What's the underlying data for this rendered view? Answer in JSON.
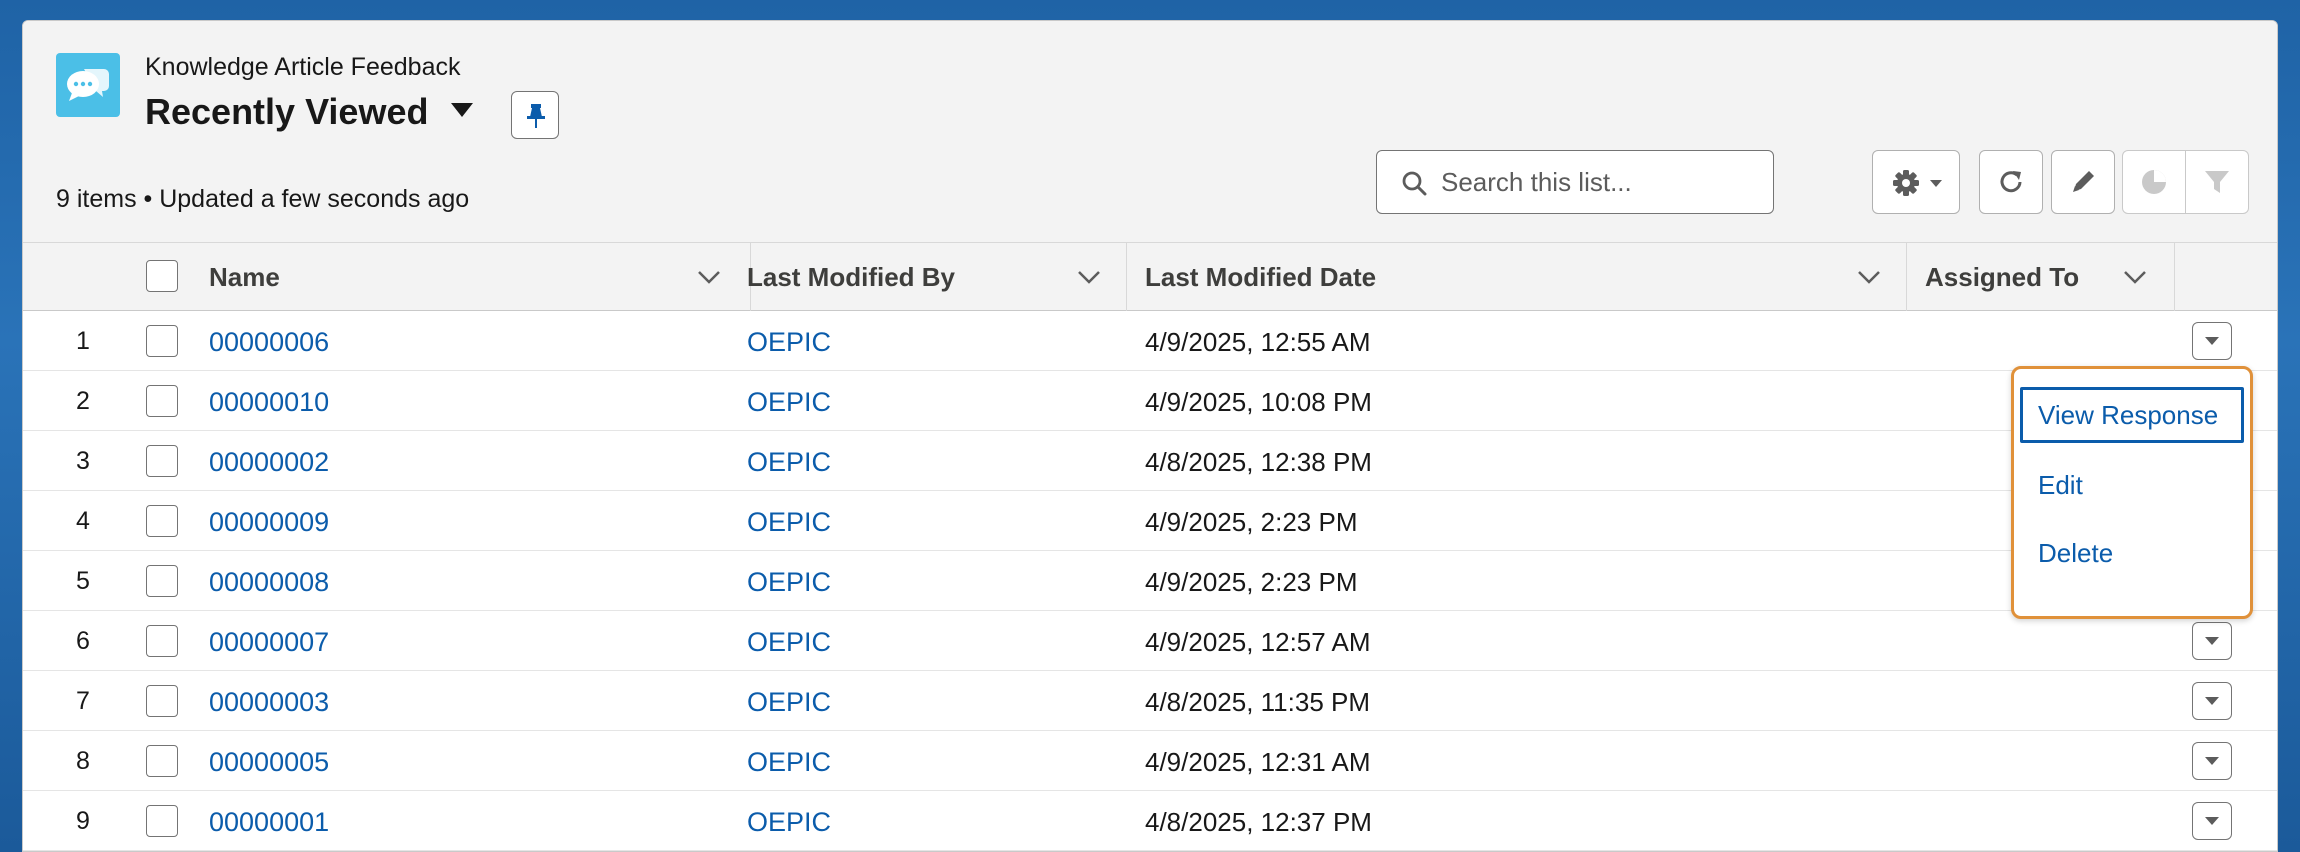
{
  "header": {
    "object_name": "Knowledge Article Feedback",
    "list_title": "Recently Viewed",
    "status": "9 items • Updated a few seconds ago"
  },
  "search": {
    "placeholder": "Search this list...",
    "value": ""
  },
  "toolbar": {
    "icons": [
      "gear-icon",
      "refresh-icon",
      "pencil-icon",
      "chart-icon",
      "filter-icon"
    ]
  },
  "table": {
    "columns": [
      "Name",
      "Last Modified By",
      "Last Modified Date",
      "Assigned To"
    ],
    "rows": [
      {
        "num": "1",
        "name": "00000006",
        "modified_by": "OEPIC",
        "modified_date": "4/9/2025, 12:55 AM"
      },
      {
        "num": "2",
        "name": "00000010",
        "modified_by": "OEPIC",
        "modified_date": "4/9/2025, 10:08 PM"
      },
      {
        "num": "3",
        "name": "00000002",
        "modified_by": "OEPIC",
        "modified_date": "4/8/2025, 12:38 PM"
      },
      {
        "num": "4",
        "name": "00000009",
        "modified_by": "OEPIC",
        "modified_date": "4/9/2025, 2:23 PM"
      },
      {
        "num": "5",
        "name": "00000008",
        "modified_by": "OEPIC",
        "modified_date": "4/9/2025, 2:23 PM"
      },
      {
        "num": "6",
        "name": "00000007",
        "modified_by": "OEPIC",
        "modified_date": "4/9/2025, 12:57 AM"
      },
      {
        "num": "7",
        "name": "00000003",
        "modified_by": "OEPIC",
        "modified_date": "4/8/2025, 11:35 PM"
      },
      {
        "num": "8",
        "name": "00000005",
        "modified_by": "OEPIC",
        "modified_date": "4/9/2025, 12:31 AM"
      },
      {
        "num": "9",
        "name": "00000001",
        "modified_by": "OEPIC",
        "modified_date": "4/8/2025, 12:37 PM"
      }
    ]
  },
  "row_menu": {
    "items": [
      "View Response",
      "Edit",
      "Delete"
    ],
    "focused": "View Response"
  },
  "colors": {
    "link": "#0b5cab",
    "menu_highlight": "#e0913a",
    "icon_bg": "#4bbfe7"
  }
}
